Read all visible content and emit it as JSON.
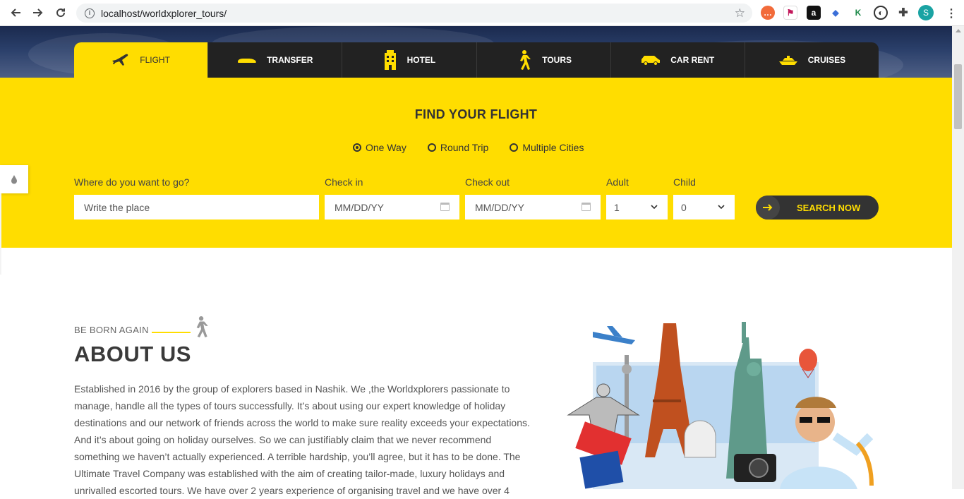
{
  "browser": {
    "url": "localhost/worldxplorer_tours/",
    "profile_initial": "S"
  },
  "tabs": [
    {
      "label": "FLIGHT",
      "icon": "plane-icon",
      "active": true
    },
    {
      "label": "TRANSFER",
      "icon": "car-icon",
      "active": false
    },
    {
      "label": "HOTEL",
      "icon": "hotel-icon",
      "active": false
    },
    {
      "label": "TOURS",
      "icon": "walker-icon",
      "active": false
    },
    {
      "label": "CAR RENT",
      "icon": "van-icon",
      "active": false
    },
    {
      "label": "CRUISES",
      "icon": "ship-icon",
      "active": false
    }
  ],
  "search": {
    "title": "FIND YOUR FLIGHT",
    "trip_types": [
      {
        "label": "One Way",
        "checked": true
      },
      {
        "label": "Round Trip",
        "checked": false
      },
      {
        "label": "Multiple Cities",
        "checked": false
      }
    ],
    "destination_label": "Where do you want to go?",
    "destination_placeholder": "Write the place",
    "checkin_label": "Check in",
    "checkin_placeholder": "MM/DD/YY",
    "checkout_label": "Check out",
    "checkout_placeholder": "MM/DD/YY",
    "adult_label": "Adult",
    "adult_value": "1",
    "child_label": "Child",
    "child_value": "0",
    "button_label": "SEARCH NOW"
  },
  "about": {
    "subheading": "BE BORN AGAIN",
    "title": "ABOUT US",
    "text": "Established in 2016 by the group of explorers based in Nashik. We ,the Worldxplorers passionate to manage, handle all the types of tours successfully. It’s about using our expert knowledge of holiday destinations and our network of friends across the world to make sure reality exceeds your expectations. And it’s about going on holiday ourselves. So we can justifiably claim that we never recommend something we haven’t actually experienced. A terrible hardship, you’ll agree, but it has to be done. The Ultimate Travel Company was established with the aim of creating tailor-made, luxury holidays and unrivalled escorted tours. We have over 2 years experience of organising travel and we have over 4"
  },
  "colors": {
    "accent": "#ffdd00",
    "dark": "#222222"
  }
}
